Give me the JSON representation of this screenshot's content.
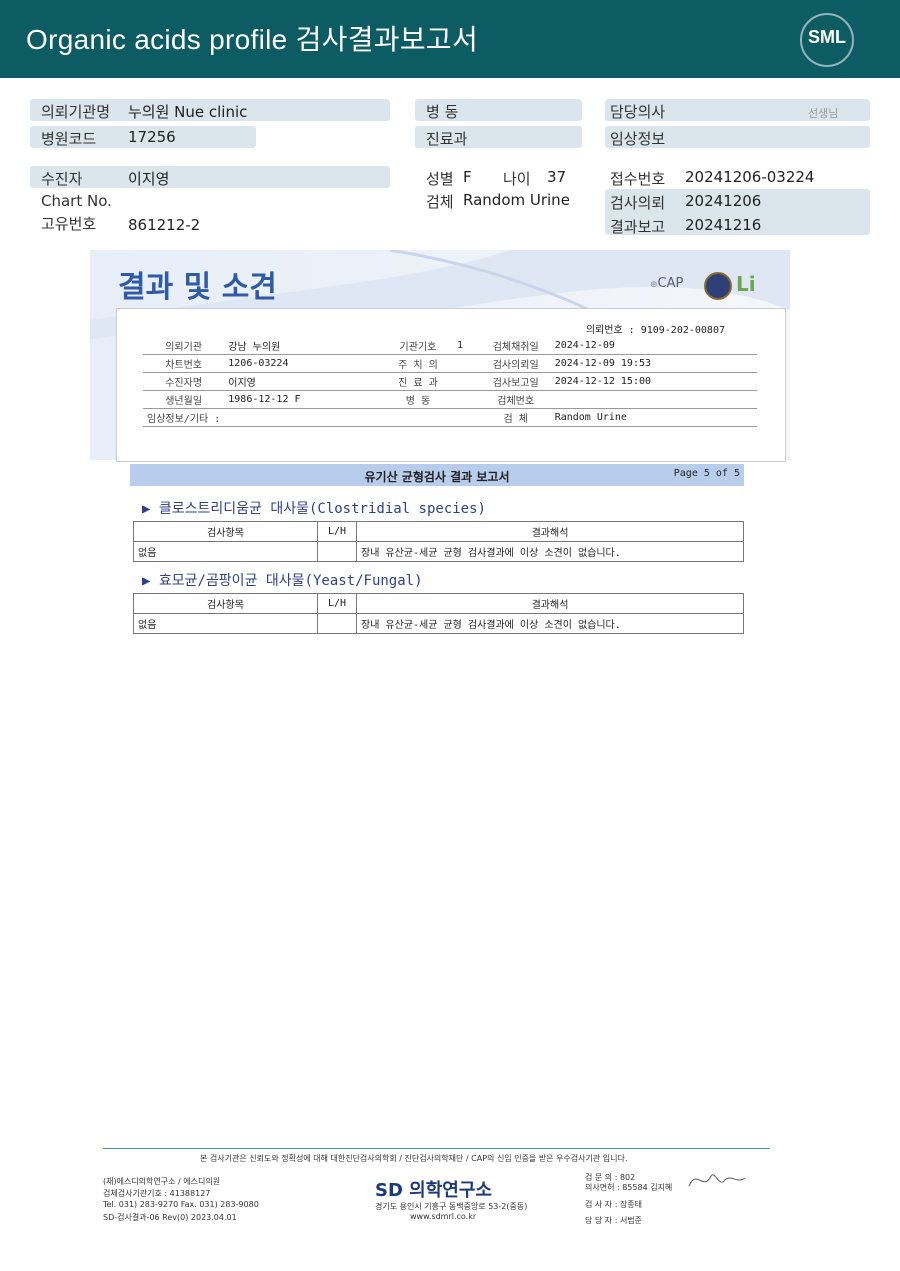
{
  "header": {
    "title": "Organic acids profile 검사결과보고서",
    "logo": "SML"
  },
  "info": {
    "institution_label": "의뢰기관명",
    "institution_value": "누의원 Nue clinic",
    "hospital_code_label": "병원코드",
    "hospital_code_value": "17256",
    "ward_label": "병  동",
    "department_label": "진료과",
    "doctor_label": "담당의사",
    "doctor_suffix": "선생님",
    "clinical_label": "임상정보",
    "patient_label": "수진자",
    "patient_value": "이지영",
    "chart_label": "Chart No.",
    "id_label": "고유번호",
    "id_value": "861212-2",
    "sex_label": "성별",
    "sex_value": "F",
    "age_label": "나이",
    "age_value": "37",
    "specimen_label": "검체",
    "specimen_value": "Random Urine",
    "receipt_label": "접수번호",
    "receipt_value": "20241206-03224",
    "request_label": "검사의뢰",
    "request_value": "20241206",
    "report_label": "결과보고",
    "report_value": "20241216"
  },
  "doc": {
    "title": "결과 및 소견",
    "cert_cap": "CAP",
    "request_no": "의뢰번호 : 9109-202-00807",
    "rows": [
      [
        "의뢰기관",
        "강남 누의원",
        "기관기호",
        "1",
        "검체채취일",
        "2024-12-09"
      ],
      [
        "차트번호",
        "1206-03224",
        "주 치 의",
        "",
        "검사의뢰일",
        "2024-12-09 19:53"
      ],
      [
        "수진자명",
        "이지영",
        "진 료 과",
        "",
        "검사보고일",
        "2024-12-12 15:00"
      ],
      [
        "생년월일",
        "1986-12-12          F",
        "병     동",
        "",
        "검체번호",
        ""
      ],
      [
        "임상정보/기타 :",
        "",
        "",
        "",
        "검     체",
        "Random Urine"
      ]
    ],
    "bar_title": "유기산 균형검사 결과 보고서",
    "page": "Page 5 of 5",
    "sections": [
      {
        "title": "▶ 클로스트리디움균 대사물(Clostridial species)",
        "headers": [
          "검사항목",
          "L/H",
          "결과해석"
        ],
        "row": [
          "없음",
          "",
          "장내 유산균-세균 균형 검사결과에 이상 소견이 없습니다."
        ]
      },
      {
        "title": "▶ 효모균/곰팡이균 대사물(Yeast/Fungal)",
        "headers": [
          "검사항목",
          "L/H",
          "결과해석"
        ],
        "row": [
          "없음",
          "",
          "장내 유산균-세균 균형 검사결과에 이상 소견이 없습니다."
        ]
      }
    ]
  },
  "footer": {
    "notice": "본 검사기관은 신뢰도와 정확성에 대해 대한진단검사의학회 / 진단검사의학재단 / CAP의 신임 인증을 받은 우수검사기관 입니다.",
    "left1": "(재)에스디의학연구소 / 에스디의원",
    "left2": "검체검사기관기호 : 41388127",
    "left3": "Tel. 031) 283-9270        Fax. 031) 283-9080",
    "left4": "SD-검사결과-06 Rev(0) 2023.04.01",
    "brand": "SD 의학연구소",
    "addr1": "경기도 용인시 기흥구 동백중앙로 53-2(중동)",
    "addr2": "www.sdmrl.co.kr",
    "r1": "검 문 의 :  802",
    "r2": "의사면허 :  85584  김지혜",
    "r3": "검 사 자 :           장종태",
    "r4": "담 당 자 :           서범준"
  }
}
